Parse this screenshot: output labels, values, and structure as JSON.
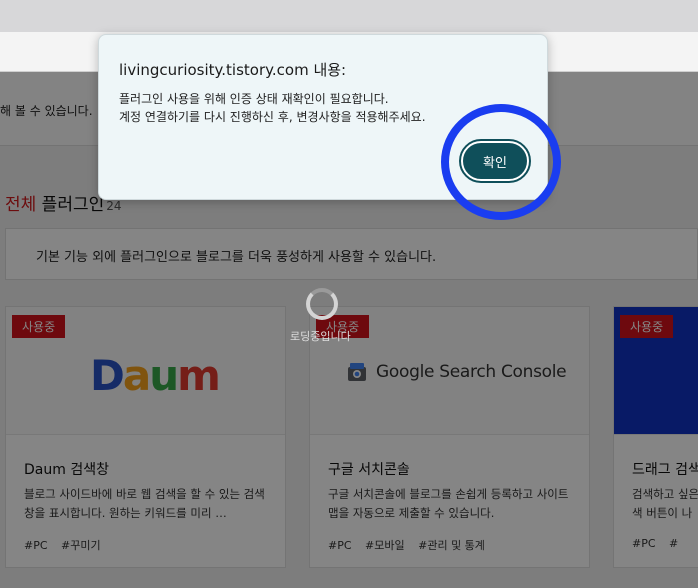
{
  "dialog": {
    "origin": "livingcuriosity.tistory.com 내용:",
    "message_line1": "플러그인 사용을 위해 인증 상태 재확인이 필요합니다.",
    "message_line2": "계정 연결하기를 다시 진행하신 후, 변경사항을 적용해주세요.",
    "ok_label": "확인"
  },
  "page": {
    "notice": "해 볼 수 있습니다.",
    "section_title_accent": "전체",
    "section_title_rest": " 플러그인",
    "section_count": "24",
    "info": "기본 기능 외에 플러그인으로 블로그를 더욱 풍성하게 사용할 수 있습니다.",
    "loading": "로딩중입니다"
  },
  "cards": [
    {
      "badge": "사용중",
      "name": "Daum 검색창",
      "desc": "블로그 사이드바에 바로 웹 검색을 할 수 있는 검색창을 표시합니다. 원하는 키워드를 미리 …",
      "tags": [
        "#PC",
        "#꾸미기"
      ],
      "logo": {
        "d": "D",
        "a": "a",
        "u": "u",
        "m": "m"
      }
    },
    {
      "badge": "사용중",
      "name": "구글 서치콘솔",
      "desc": "구글 서치콘솔에 블로그를 손쉽게 등록하고 사이트맵을 자동으로 제출할 수 있습니다.",
      "tags": [
        "#PC",
        "#모바일",
        "#관리 및 통계"
      ],
      "logo_text": "Google Search Console"
    },
    {
      "badge": "사용중",
      "name": "드래그 검색",
      "desc": "검색하고 싶은 색 버튼이 나",
      "tags": [
        "#PC",
        "#"
      ]
    }
  ],
  "colors": {
    "accent_red": "#d3131b",
    "dialog_button": "#0f4f5a",
    "highlight_ring": "#1a3df0"
  }
}
